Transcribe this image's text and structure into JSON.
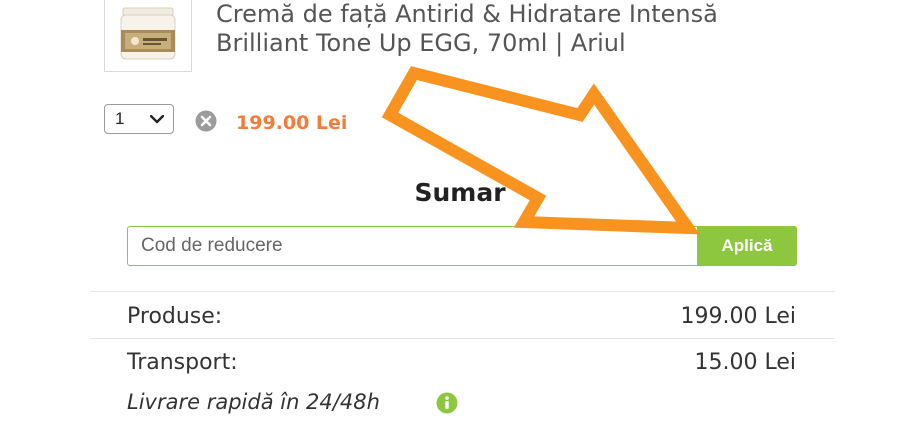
{
  "product": {
    "title": "Cremă de față Antirid & Hidratare Intensă Brilliant Tone Up EGG, 70ml | Ariul",
    "quantity": "1",
    "price": "199.00 Lei"
  },
  "summary": {
    "title": "Sumar",
    "coupon_placeholder": "Cod de reducere",
    "apply_label": "Aplică",
    "products_label": "Produse:",
    "products_value": "199.00 Lei",
    "transport_label": "Transport:",
    "transport_value": "15.00 Lei",
    "delivery_note": "Livrare rapidă în 24/48h"
  },
  "colors": {
    "accent_green": "#8dc63f",
    "price_orange": "#f27c38",
    "arrow_orange": "#f7931e"
  },
  "icons": {
    "remove": "remove-x-circle-icon",
    "info": "info-circle-icon",
    "dropdown": "chevron-down-icon"
  }
}
